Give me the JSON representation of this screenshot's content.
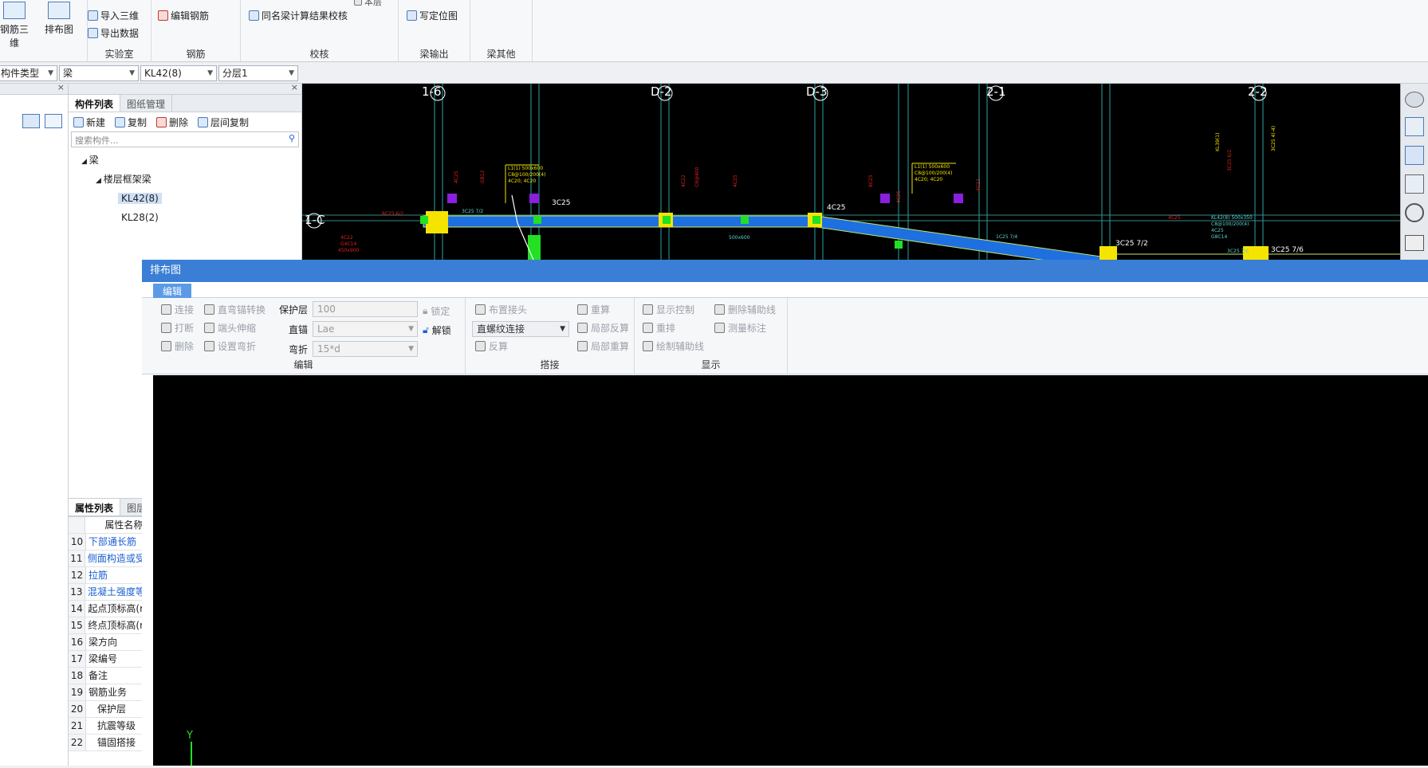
{
  "ribbon": {
    "big_buttons": [
      {
        "label": "钢筋三维"
      },
      {
        "label": "排布图"
      }
    ],
    "lab": {
      "title": "实验室",
      "items": [
        "导入三维",
        "导出数据"
      ]
    },
    "rebar": {
      "title": "钢筋",
      "items": [
        "编辑钢筋"
      ]
    },
    "check": {
      "title": "校核",
      "items": [
        "同名梁计算结果校核"
      ],
      "partial": "本层"
    },
    "output": {
      "title": "梁输出",
      "items": [
        "写定位图"
      ]
    },
    "other": {
      "title": "梁其他"
    }
  },
  "combos": [
    {
      "value": "构件类型"
    },
    {
      "value": "梁"
    },
    {
      "value": "KL42(8)"
    },
    {
      "value": "分层1"
    }
  ],
  "mid_panel": {
    "tabs": [
      "构件列表",
      "图纸管理"
    ],
    "toolbar": [
      "新建",
      "复制",
      "删除",
      "层间复制"
    ],
    "search_placeholder": "搜索构件...",
    "tree": {
      "root": "梁",
      "group": "楼层框架梁",
      "items": [
        "KL42(8)",
        "KL28(2)"
      ],
      "selected": "KL42(8)"
    },
    "prop_tabs": [
      "属性列表",
      "图层"
    ],
    "prop_header": "属性名称",
    "properties": [
      {
        "no": "10",
        "name": "下部通长筋",
        "blue": true
      },
      {
        "no": "11",
        "name": "侧面构造或受",
        "blue": true
      },
      {
        "no": "12",
        "name": "拉筋",
        "blue": true
      },
      {
        "no": "13",
        "name": "混凝土强度等",
        "blue": true
      },
      {
        "no": "14",
        "name": "起点顶标高(r",
        "blue": false
      },
      {
        "no": "15",
        "name": "终点顶标高(r",
        "blue": false
      },
      {
        "no": "16",
        "name": "梁方向",
        "blue": false
      },
      {
        "no": "17",
        "name": "梁编号",
        "blue": false
      },
      {
        "no": "18",
        "name": "备注",
        "blue": false
      },
      {
        "no": "19",
        "name": "钢筋业务",
        "blue": false
      },
      {
        "no": "20",
        "name": "保护层",
        "blue": false
      },
      {
        "no": "21",
        "name": "抗震等级",
        "blue": false
      },
      {
        "no": "22",
        "name": "锚固搭接",
        "blue": false
      }
    ]
  },
  "canvas": {
    "axes": [
      "1-6",
      "D-2",
      "D-3",
      "2-1",
      "2-2"
    ],
    "row_axis": "1-C",
    "annotations": [
      "3C25",
      "3C25 7/2",
      "3C25 7/6",
      "8C25 6/2",
      "4C25"
    ]
  },
  "dialog": {
    "title": "排布图",
    "tab": "编辑",
    "edit_group": {
      "title": "编辑",
      "buttons": [
        "连接",
        "打断",
        "删除",
        "直弯锚转换",
        "端头伸缩",
        "设置弯折"
      ],
      "cover_label": "保护层",
      "cover_value": "100",
      "anchor_label": "直锚",
      "anchor_value": "Lae",
      "bend_label": "弯折",
      "bend_value": "15*d",
      "lock": "锁定",
      "unlock": "解锁"
    },
    "splice_group": {
      "title": "搭接",
      "buttons": [
        "布置接头",
        "反算",
        "重算",
        "局部反算",
        "局部重算"
      ],
      "splice_type": "直螺纹连接"
    },
    "display_group": {
      "title": "显示",
      "buttons": [
        "显示控制",
        "重排",
        "绘制辅助线",
        "删除辅助线",
        "测量标注"
      ]
    },
    "axis_label": "Y"
  }
}
